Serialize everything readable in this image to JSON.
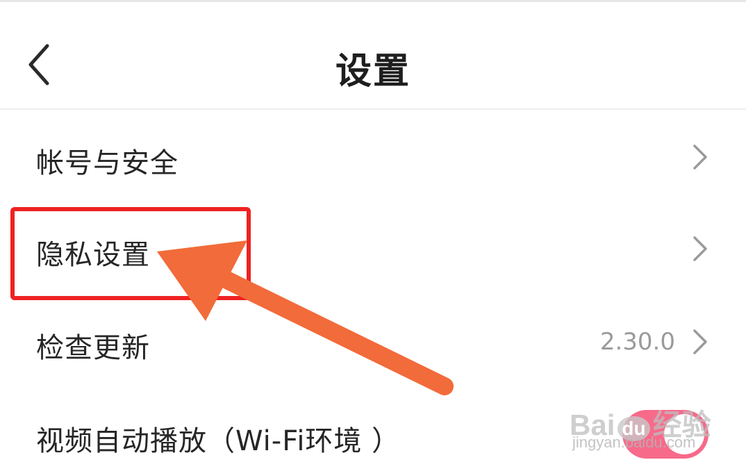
{
  "header": {
    "title": "设置"
  },
  "settings": [
    {
      "label": "帐号与安全",
      "value": ""
    },
    {
      "label": "隐私设置",
      "value": ""
    },
    {
      "label": "检查更新",
      "value": "2.30.0"
    },
    {
      "label": "视频自动播放（Wi-Fi环境 ）",
      "value": ""
    }
  ],
  "toggle": {
    "state": "on"
  },
  "watermark": {
    "brand_prefix": "Bai",
    "brand_du": "du",
    "brand_suffix": "经验",
    "url": "jingyan.baidu.com"
  },
  "colors": {
    "highlight": "#ee2222",
    "arrow": "#f26b3a",
    "toggle_on": "#f76a8a"
  },
  "icons": {
    "back": "chevron-left-icon",
    "row": "chevron-right-icon"
  }
}
